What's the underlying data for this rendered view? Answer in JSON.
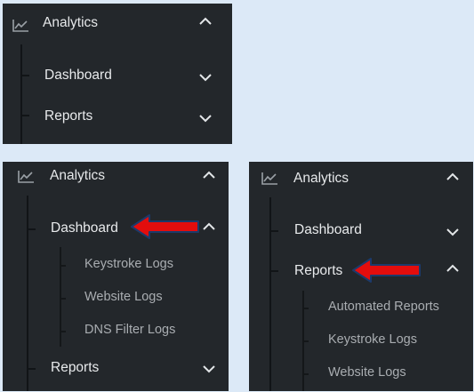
{
  "panel1": {
    "header": {
      "label": "Analytics",
      "icon": "line-chart-icon",
      "state": "expanded"
    },
    "items": [
      {
        "label": "Dashboard",
        "state": "collapsed"
      },
      {
        "label": "Reports",
        "state": "collapsed"
      }
    ]
  },
  "panel2": {
    "header": {
      "label": "Analytics",
      "icon": "line-chart-icon",
      "state": "expanded"
    },
    "items": [
      {
        "label": "Dashboard",
        "state": "expanded",
        "children": [
          "Keystroke Logs",
          "Website Logs",
          "DNS Filter Logs"
        ]
      },
      {
        "label": "Reports",
        "state": "collapsed"
      }
    ]
  },
  "panel3": {
    "header": {
      "label": "Analytics",
      "icon": "line-chart-icon",
      "state": "expanded"
    },
    "items": [
      {
        "label": "Dashboard",
        "state": "collapsed"
      },
      {
        "label": "Reports",
        "state": "expanded",
        "children": [
          "Automated Reports",
          "Keystroke Logs",
          "Website Logs"
        ]
      }
    ]
  },
  "colors": {
    "page_background": "#dce9f7",
    "panel_background": "#23272b",
    "primary_text": "#e6e8ea",
    "secondary_text": "#a9adb1",
    "annotation_arrow": "#e30d0d",
    "annotation_outline": "#1c3a6b"
  }
}
